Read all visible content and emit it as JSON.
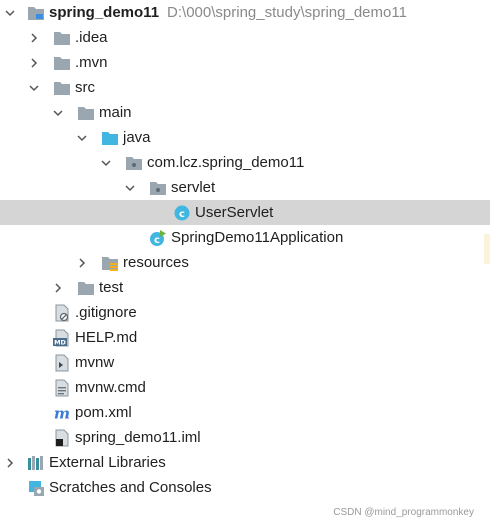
{
  "tree": {
    "items": [
      {
        "label": "spring_demo11",
        "path": "D:\\000\\spring_study\\spring_demo11",
        "icon": "module-folder-icon",
        "arrow": "down",
        "depth": 0
      },
      {
        "label": ".idea",
        "icon": "folder-icon",
        "arrow": "right",
        "depth": 1
      },
      {
        "label": ".mvn",
        "icon": "folder-icon",
        "arrow": "right",
        "depth": 1
      },
      {
        "label": "src",
        "icon": "folder-icon",
        "arrow": "down",
        "depth": 1
      },
      {
        "label": "main",
        "icon": "folder-icon",
        "arrow": "down",
        "depth": 2
      },
      {
        "label": "java",
        "icon": "source-folder-icon",
        "arrow": "down",
        "depth": 3
      },
      {
        "label": "com.lcz.spring_demo11",
        "icon": "package-icon",
        "arrow": "down",
        "depth": 4
      },
      {
        "label": "servlet",
        "icon": "package-icon",
        "arrow": "down",
        "depth": 5
      },
      {
        "label": "UserServlet",
        "icon": "java-class-icon",
        "arrow": "none",
        "depth": 6,
        "selected": true
      },
      {
        "label": "SpringDemo11Application",
        "icon": "spring-boot-class-icon",
        "arrow": "none",
        "depth": 5
      },
      {
        "label": "resources",
        "icon": "resources-folder-icon",
        "arrow": "right",
        "depth": 3
      },
      {
        "label": "test",
        "icon": "folder-icon",
        "arrow": "right",
        "depth": 2
      },
      {
        "label": ".gitignore",
        "icon": "gitignore-file-icon",
        "arrow": "none",
        "depth": 1
      },
      {
        "label": "HELP.md",
        "icon": "markdown-file-icon",
        "arrow": "none",
        "depth": 1
      },
      {
        "label": "mvnw",
        "icon": "script-file-icon",
        "arrow": "none",
        "depth": 1
      },
      {
        "label": "mvnw.cmd",
        "icon": "text-file-icon",
        "arrow": "none",
        "depth": 1
      },
      {
        "label": "pom.xml",
        "icon": "maven-icon",
        "arrow": "none",
        "depth": 1
      },
      {
        "label": "spring_demo11.iml",
        "icon": "iml-file-icon",
        "arrow": "none",
        "depth": 1
      },
      {
        "label": "External Libraries",
        "icon": "libraries-icon",
        "arrow": "right",
        "depth": 0
      },
      {
        "label": "Scratches and Consoles",
        "icon": "scratches-icon",
        "arrow": "none",
        "depth": 0
      }
    ]
  },
  "watermark": "CSDN @mind_programmonkey",
  "colors": {
    "selection": "#d5d5d5",
    "folder": "#9aa7b0",
    "source_folder": "#40b6e0",
    "class_icon": "#40b6e0",
    "spring_green": "#6db33f",
    "maven_blue": "#3d7bd6"
  }
}
